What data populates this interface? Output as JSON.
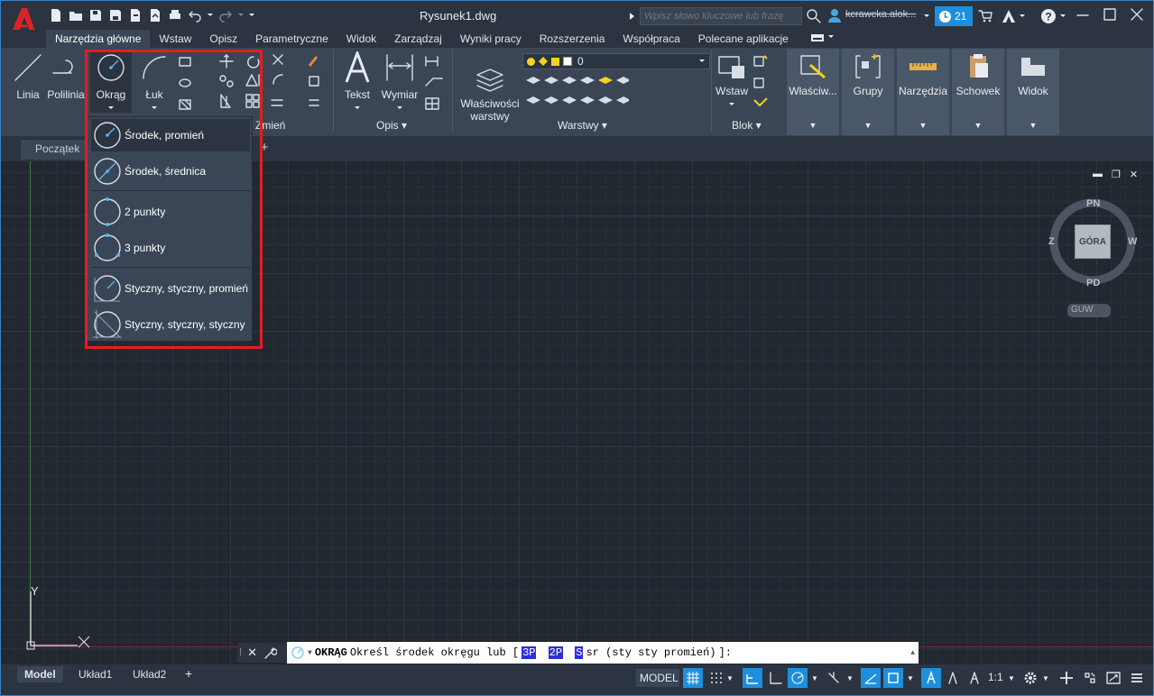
{
  "window": {
    "title": "Rysunek1.dwg",
    "search_placeholder": "Wpisz słowo kluczowe lub frazę",
    "user": "kcrawcka.alok...",
    "notifications": "21"
  },
  "ribbon_tabs": [
    "Narzędzia główne",
    "Wstaw",
    "Opisz",
    "Parametryczne",
    "Widok",
    "Zarządzaj",
    "Wyniki pracy",
    "Rozszerzenia",
    "Współpraca",
    "Polecane aplikacje"
  ],
  "ribbon": {
    "draw": {
      "line": "Linia",
      "polyline": "Polilinia",
      "circle": "Okrąg",
      "arc": "Łuk"
    },
    "modify_label": "Zmień",
    "annotation": {
      "text": "Tekst",
      "dimension": "Wymiar",
      "panel_label": "Opis"
    },
    "layers": {
      "properties": "Właściwości\nwarstwy",
      "current_layer": "0",
      "panel_label": "Warstwy"
    },
    "block": {
      "insert": "Wstaw",
      "panel_label": "Blok"
    },
    "properties": "Właściw...",
    "groups": "Grupy",
    "utilities": "Narzędzia",
    "clipboard": "Schowek",
    "view": "Widok"
  },
  "circle_menu": {
    "items": [
      "Środek, promień",
      "Środek, średnica",
      "2 punkty",
      "3 punkty",
      "Styczny, styczny, promień",
      "Styczny, styczny, styczny"
    ]
  },
  "doc_tabs": {
    "start": "Początek"
  },
  "viewcube": {
    "north": "PN",
    "south": "PD",
    "west": "Z",
    "east": "W",
    "face": "GÓRA",
    "wcs": "GUW"
  },
  "ucs": {
    "y": "Y"
  },
  "command": {
    "name": "OKRĄG",
    "prompt": "Określ środek okręgu lub [",
    "opt1": "3P",
    "opt2": "2P",
    "opt3_hot": "S",
    "opt3_rest": "sr (sty sty promień)",
    "end": "]:"
  },
  "layout_tabs": [
    "Model",
    "Układ1",
    "Układ2"
  ],
  "status": {
    "model": "MODEL",
    "scale": "1:1"
  },
  "colors": {
    "accent": "#1e8fdc",
    "highlight_frame": "#e41e1e",
    "ribbon": "#3a4656"
  }
}
